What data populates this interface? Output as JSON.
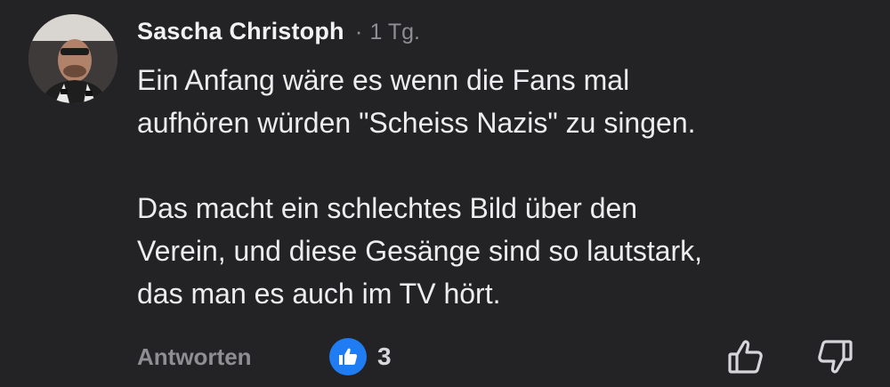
{
  "comment": {
    "author": "Sascha Christoph",
    "separator": "·",
    "time": "1 Tg.",
    "paragraphs": [
      [
        "Ein Anfang wäre es wenn die Fans mal",
        "aufhören würden \"Scheiss Nazis\" zu singen."
      ],
      [
        "Das macht ein schlechtes Bild über den",
        "Verein, und diese Gesänge sind so lautstark,",
        "das man es auch im TV hört."
      ]
    ]
  },
  "actions": {
    "reply_label": "Antworten",
    "like_count": "3",
    "like_icon": "thumbs-up-icon",
    "upvote_icon": "thumbs-up-outline-icon",
    "downvote_icon": "thumbs-down-outline-icon"
  },
  "colors": {
    "background": "#232325",
    "accent": "#1f7cf2",
    "muted": "#8e8e93"
  }
}
